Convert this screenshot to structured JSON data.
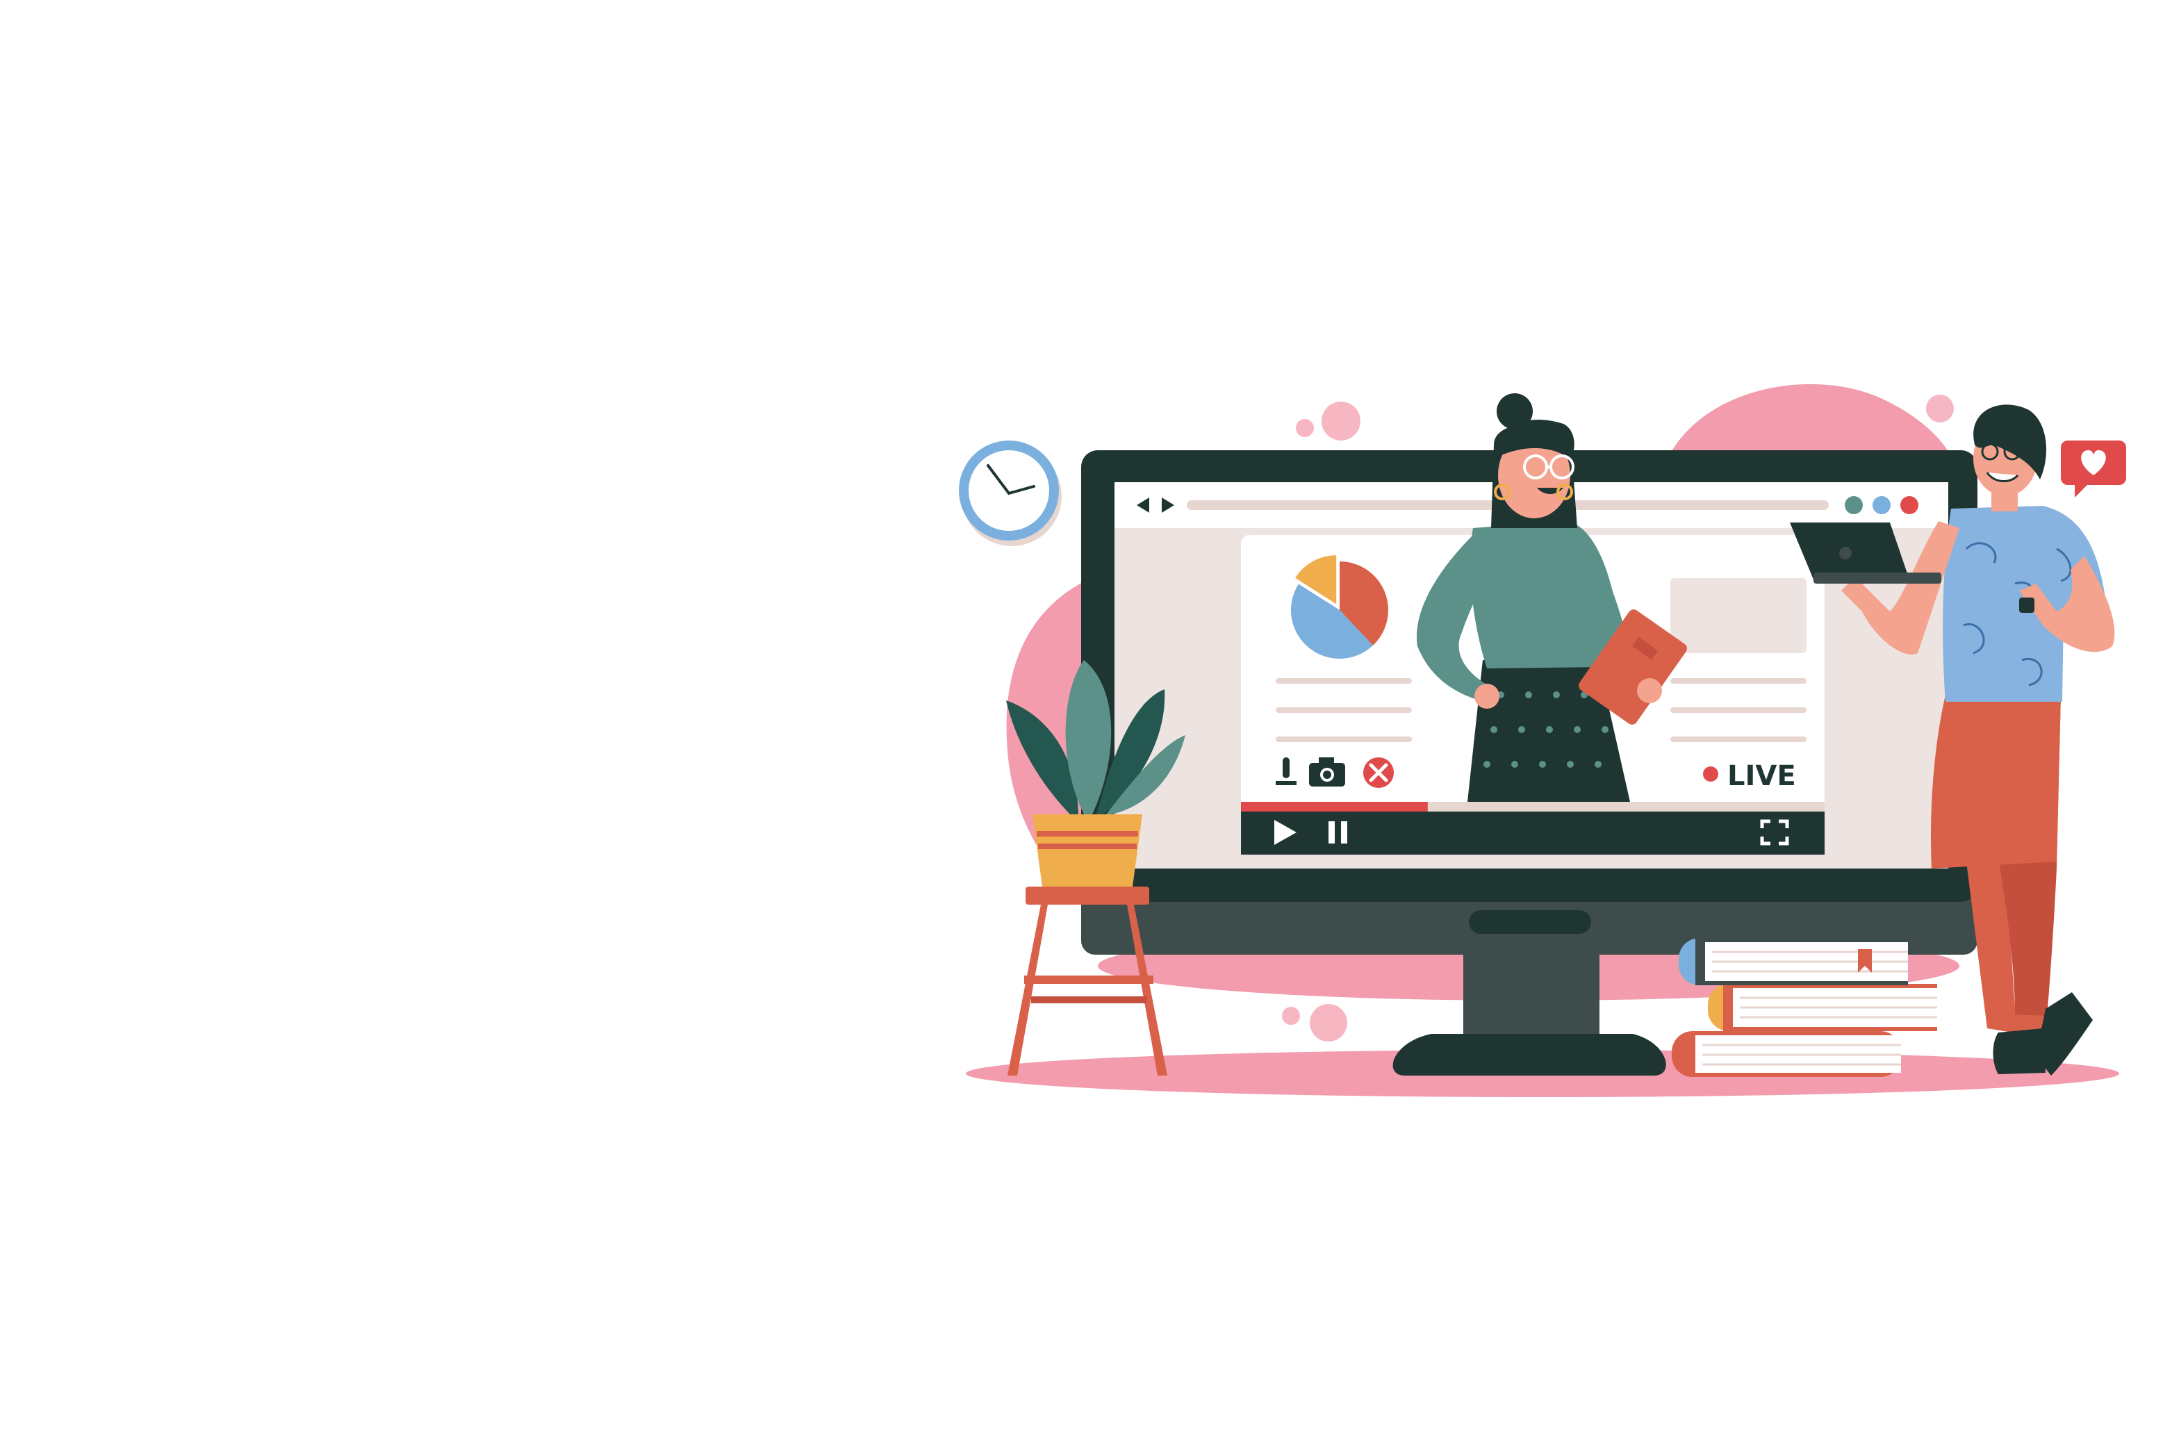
{
  "colors": {
    "background": "#ffffff",
    "pink": "#f29cad",
    "pink_light": "#f6b7c3",
    "monitor_dark": "#1e3532",
    "monitor_base": "#3e4d4b",
    "screen_bg": "#ede3e0",
    "teal": "#5b9189",
    "teal_dark": "#24574f",
    "coral": "#d9614a",
    "coral_dark": "#c44f3c",
    "orange": "#f0ad4b",
    "blue": "#7aafde",
    "blue_shirt": "#86b3df",
    "skin": "#f4a38f",
    "red": "#e04a4a"
  },
  "video_player": {
    "live_label": "LIVE",
    "progress_fraction": 0.32
  },
  "pie_chart": {
    "slices": [
      {
        "name": "slice-red",
        "fraction": 0.38,
        "color": "#d9614a"
      },
      {
        "name": "slice-blue",
        "fraction": 0.46,
        "color": "#7aafde"
      },
      {
        "name": "slice-orange",
        "fraction": 0.16,
        "color": "#f0ad4b"
      }
    ]
  },
  "icons": {
    "clock": "clock-icon",
    "heart": "heart-icon",
    "play": "play-icon",
    "pause": "pause-icon",
    "fullscreen": "fullscreen-icon",
    "microphone": "microphone-icon",
    "camera": "camera-icon",
    "close": "close-icon",
    "back": "back-arrow-icon",
    "forward": "forward-arrow-icon"
  }
}
